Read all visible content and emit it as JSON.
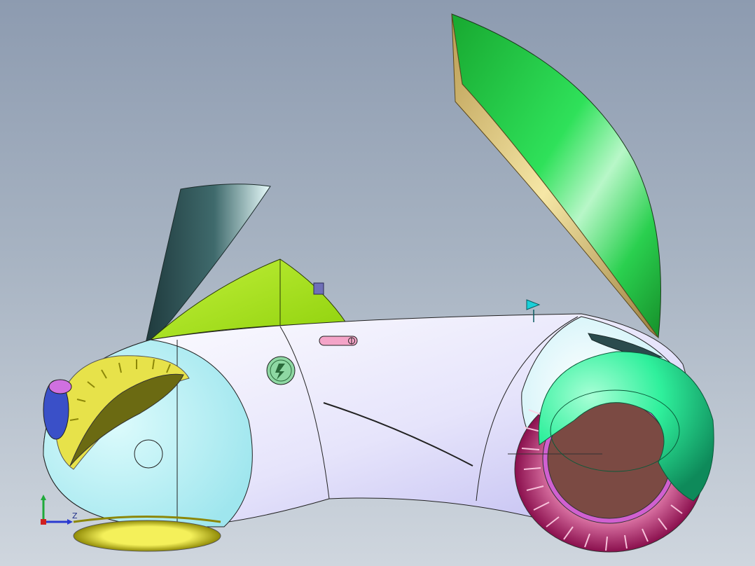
{
  "viewport": {
    "background_top": "#8d9bb0",
    "background_bottom": "#cfd6de"
  },
  "triad": {
    "axis_label": "Z"
  },
  "colors": {
    "body_white": "#f4f5ff",
    "body_lavender": "#c9c6f6",
    "front_fairing": "#c9f6f8",
    "rear_fairing": "#d8f6fb",
    "lime_shell": "#a8e316",
    "wing_green": "#20c43a",
    "wing_edge": "#d8bd73",
    "dark_fin": "#2b4b4d",
    "mint_ring": "#28f09a",
    "brown_disc": "#7b4a43",
    "rear_tire": "#c82b7e",
    "front_tire": "#d8d21d",
    "front_dome": "#6a6a12",
    "badge_green": "#8ed8a3",
    "pink_slot": "#f4a4c8",
    "cyan_marker": "#1ad0d8"
  }
}
